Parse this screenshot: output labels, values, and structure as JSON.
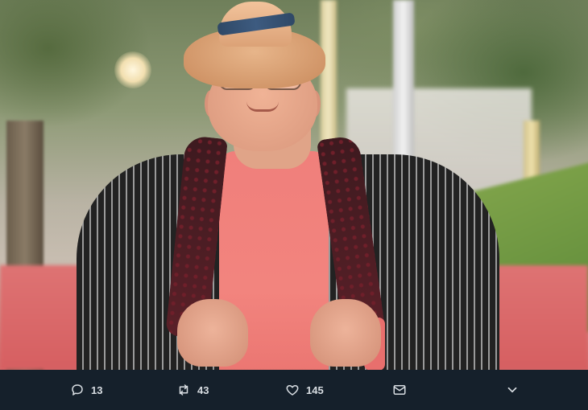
{
  "tweet": {
    "photo": {
      "subject": "man-in-straw-hat-on-red-carpet",
      "colors": {
        "carpet": "#d65f61",
        "shirt": "#f2847e",
        "hat_band": "#3d5b80"
      }
    },
    "actions": {
      "reply": {
        "icon": "reply-icon",
        "count": "13"
      },
      "retweet": {
        "icon": "retweet-icon",
        "count": "43"
      },
      "like": {
        "icon": "heart-icon",
        "count": "145"
      },
      "message": {
        "icon": "envelope-icon"
      },
      "more": {
        "icon": "chevron-down-icon"
      }
    },
    "colors": {
      "action_bar_bg": "#15202b",
      "action_text": "#d8dde2"
    }
  }
}
